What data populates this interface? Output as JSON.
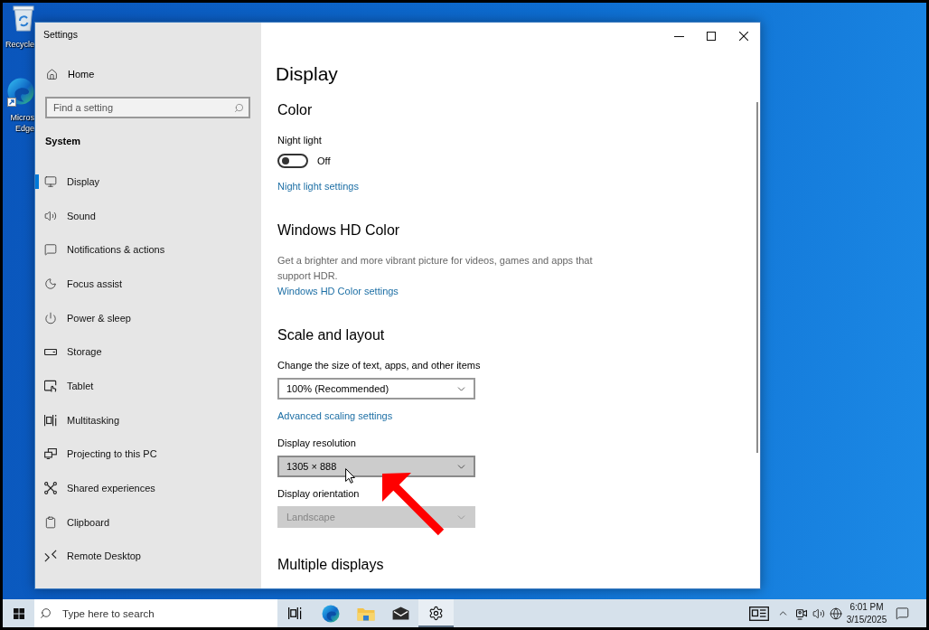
{
  "desktop": {
    "icons": [
      {
        "label_lines": [
          "Recycle"
        ]
      },
      {
        "label_lines": [
          "Micros",
          "Edge"
        ]
      }
    ]
  },
  "window": {
    "title": "Settings"
  },
  "sidebar": {
    "home": "Home",
    "search": {
      "placeholder": "Find a setting"
    },
    "section": "System",
    "items": [
      {
        "label": "Display",
        "selected": true
      },
      {
        "label": "Sound",
        "selected": false
      },
      {
        "label": "Notifications & actions",
        "selected": false
      },
      {
        "label": "Focus assist",
        "selected": false
      },
      {
        "label": "Power & sleep",
        "selected": false
      },
      {
        "label": "Storage",
        "selected": false
      },
      {
        "label": "Tablet",
        "selected": false
      },
      {
        "label": "Multitasking",
        "selected": false
      },
      {
        "label": "Projecting to this PC",
        "selected": false
      },
      {
        "label": "Shared experiences",
        "selected": false
      },
      {
        "label": "Clipboard",
        "selected": false
      },
      {
        "label": "Remote Desktop",
        "selected": false
      }
    ]
  },
  "content": {
    "title": "Display",
    "sections": [
      {
        "heading": "Color",
        "items": [
          {
            "kind": "toggle",
            "label": "Night light",
            "on": false,
            "state_text": "Off"
          },
          {
            "kind": "link",
            "text": "Night light settings"
          }
        ]
      },
      {
        "heading": "Windows HD Color",
        "items": [
          {
            "kind": "text",
            "text": "Get a brighter and more vibrant picture for videos, games and apps that support HDR."
          },
          {
            "kind": "link",
            "text": "Windows HD Color settings"
          }
        ]
      },
      {
        "heading": "Scale and layout",
        "items": [
          {
            "kind": "dropdown",
            "label": "Change the size of text, apps, and other items",
            "value": "100% (Recommended)",
            "hovered": false,
            "disabled": false
          },
          {
            "kind": "link",
            "text": "Advanced scaling settings"
          },
          {
            "kind": "dropdown",
            "label": "Display resolution",
            "value": "1305 × 888",
            "hovered": true,
            "disabled": false
          },
          {
            "kind": "dropdown",
            "label": "Display orientation",
            "value": "Landscape",
            "hovered": false,
            "disabled": true
          }
        ]
      },
      {
        "heading": "Multiple displays"
      }
    ]
  },
  "taskbar": {
    "search": {
      "placeholder": "Type here to search"
    },
    "apps": [
      {
        "running": false
      },
      {
        "running": false
      },
      {
        "running": false
      },
      {
        "running": false
      },
      {
        "running": true
      }
    ],
    "clock": {
      "time": "6:01 PM",
      "date": "3/15/2025"
    }
  }
}
